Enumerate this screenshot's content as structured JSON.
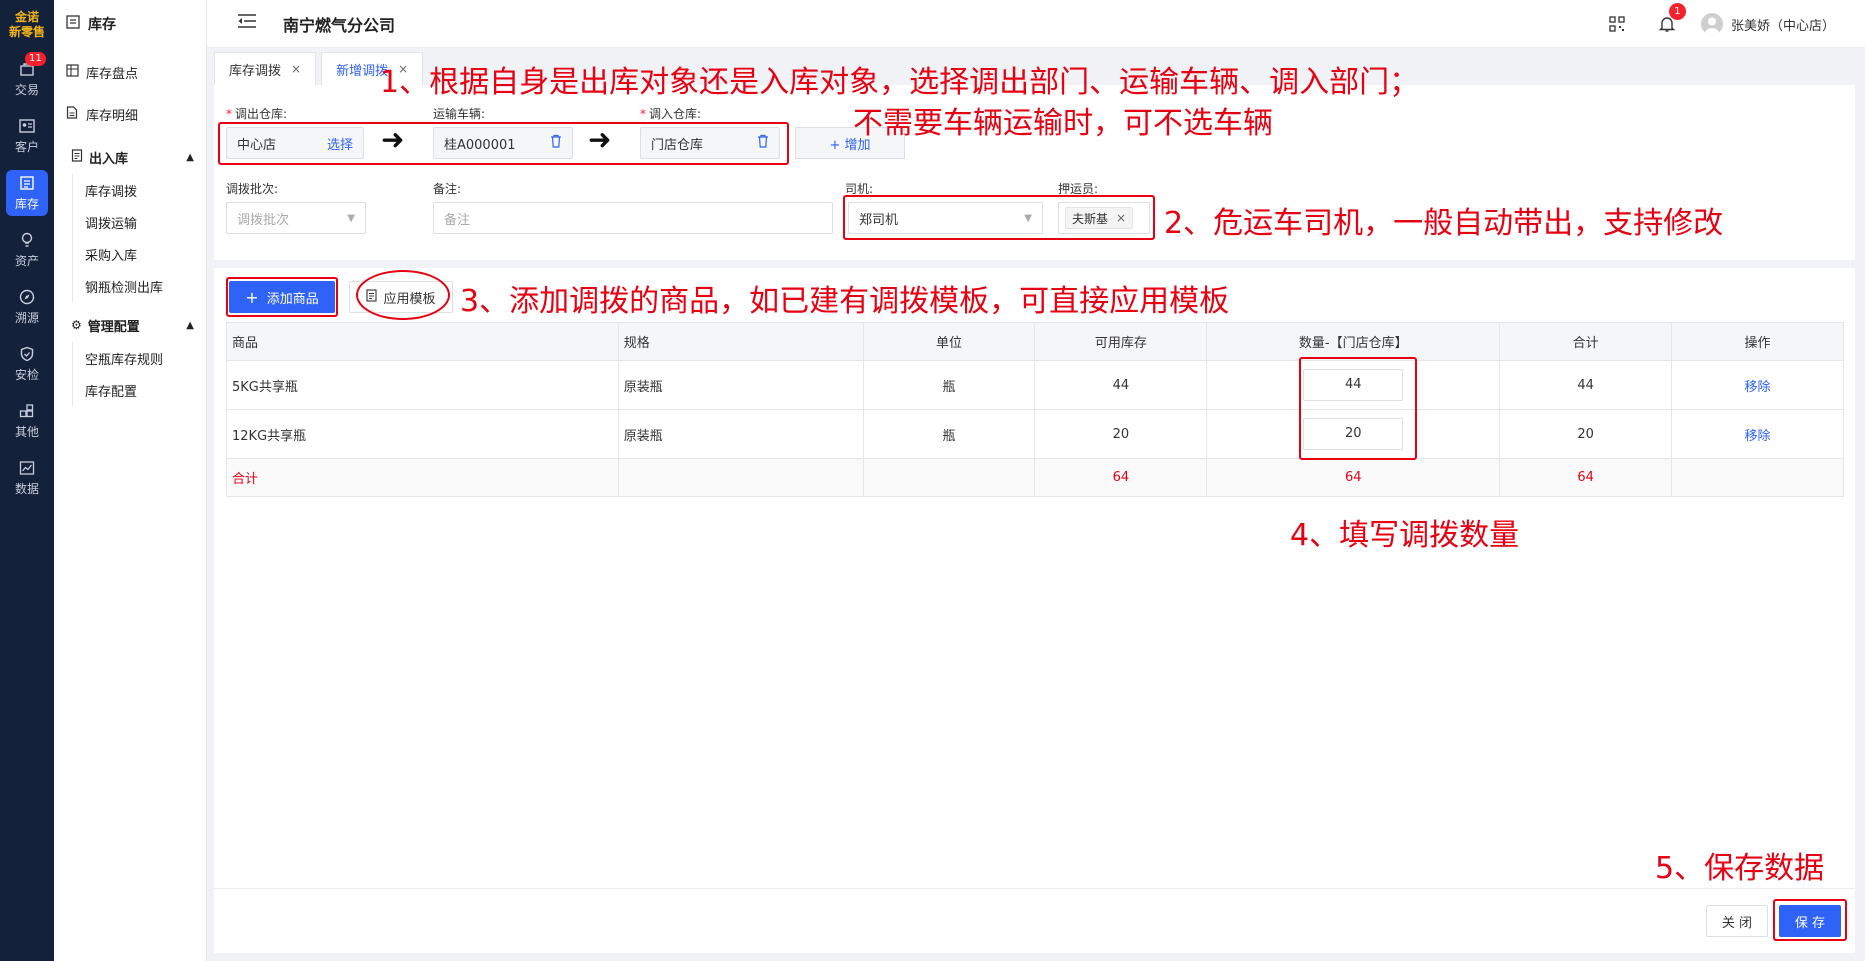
{
  "rail": {
    "logo_top": "金诺",
    "logo_bottom": "新零售",
    "items": [
      {
        "label": "交易",
        "badge": "11"
      },
      {
        "label": "客户"
      },
      {
        "label": "库存"
      },
      {
        "label": "资产"
      },
      {
        "label": "溯源"
      },
      {
        "label": "安检"
      },
      {
        "label": "其他"
      },
      {
        "label": "数据"
      }
    ]
  },
  "subnav": {
    "title": "库存",
    "items": [
      "库存盘点",
      "库存明细"
    ],
    "group1": {
      "label": "出入库",
      "children": [
        "库存调拨",
        "调拨运输",
        "采购入库",
        "钢瓶检测出库"
      ]
    },
    "group2": {
      "label": "管理配置",
      "children": [
        "空瓶库存规则",
        "库存配置"
      ]
    }
  },
  "header": {
    "company": "南宁燃气分公司",
    "notif_count": "1",
    "user": "张美娇（中心店）"
  },
  "tabs": [
    {
      "label": "库存调拨",
      "close": "×"
    },
    {
      "label": "新增调拨",
      "close": "×"
    }
  ],
  "form": {
    "out_wh_label": "调出仓库:",
    "out_wh_value": "中心店",
    "select_link": "选择",
    "vehicle_label": "运输车辆:",
    "vehicle_value": "桂A000001",
    "in_wh_label": "调入仓库:",
    "in_wh_value": "门店仓库",
    "add_label": "+ 增加",
    "batch_label": "调拨批次:",
    "batch_placeholder": "调拨批次",
    "remark_label": "备注:",
    "remark_placeholder": "备注",
    "driver_label": "司机:",
    "driver_value": "郑司机",
    "escort_label": "押运员:",
    "escort_value": "夫斯基"
  },
  "toolbar": {
    "add_goods": "添加商品",
    "apply_template": "应用模板"
  },
  "table": {
    "headers": [
      "商品",
      "规格",
      "单位",
      "可用库存",
      "数量-【门店仓库】",
      "合计",
      "操作"
    ],
    "rows": [
      {
        "name": "5KG共享瓶",
        "spec": "原装瓶",
        "unit": "瓶",
        "stock": "44",
        "qty": "44",
        "total": "44",
        "action": "移除"
      },
      {
        "name": "12KG共享瓶",
        "spec": "原装瓶",
        "unit": "瓶",
        "stock": "20",
        "qty": "20",
        "total": "20",
        "action": "移除"
      }
    ],
    "sum": {
      "label": "合计",
      "stock": "64",
      "qty": "64",
      "total": "64"
    }
  },
  "footer": {
    "close": "关 闭",
    "save": "保 存"
  },
  "annotations": {
    "a1_line1": "1、根据自身是出库对象还是入库对象，选择调出部门、运输车辆、调入部门；",
    "a1_line2": "不需要车辆运输时，可不选车辆",
    "a2": "2、危运车司机，一般自动带出，支持修改",
    "a3": "3、添加调拨的商品，如已建有调拨模板，可直接应用模板",
    "a4": "4、填写调拨数量",
    "a5": "5、保存数据"
  }
}
